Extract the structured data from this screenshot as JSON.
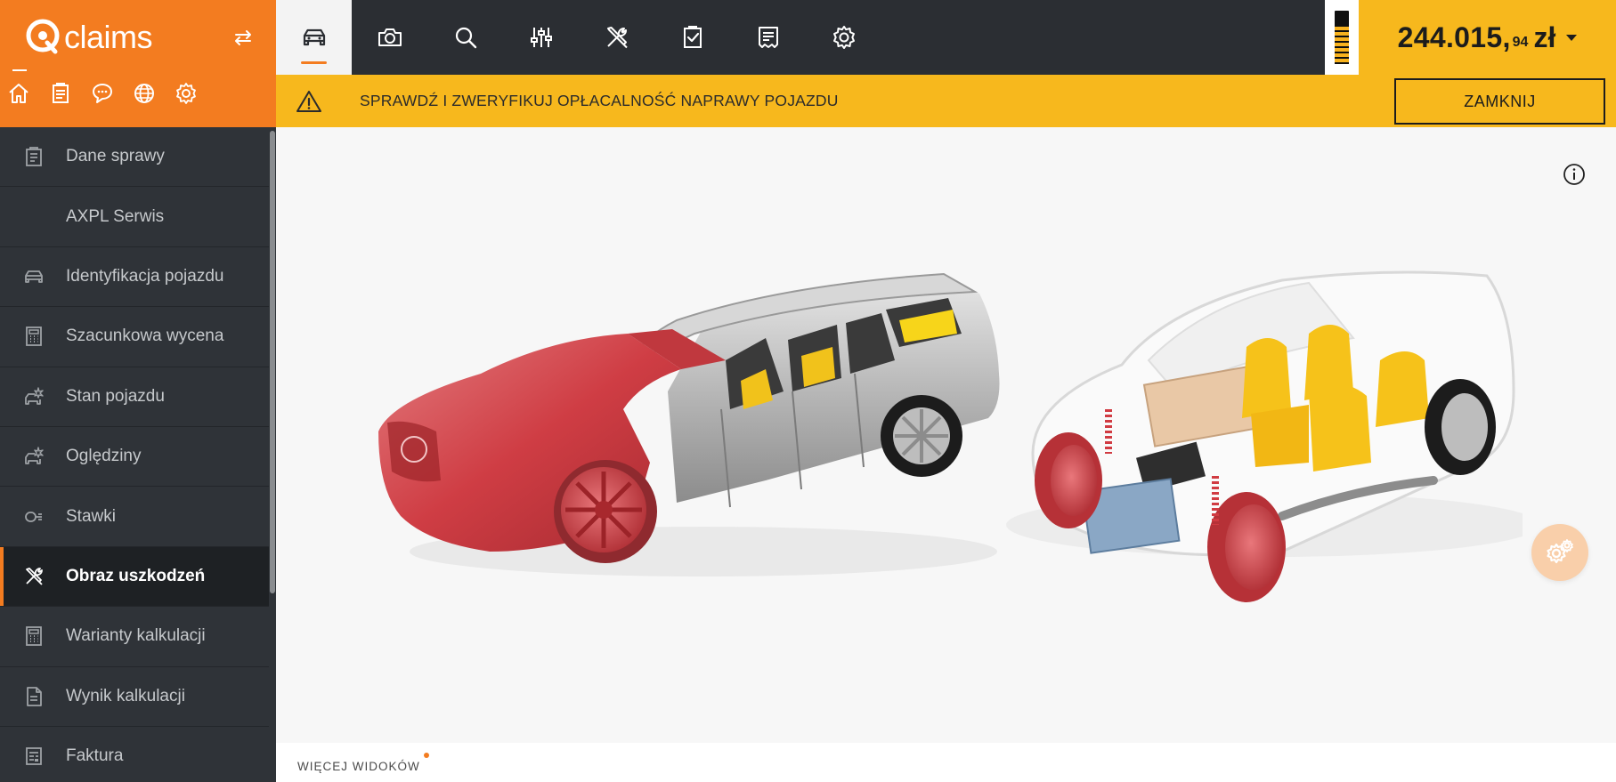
{
  "brand": {
    "logo_text": "claims",
    "accent": "#f37c20"
  },
  "quick_icons": [
    "home-icon",
    "clipboard-icon",
    "chat-icon",
    "globe-icon",
    "gear-icon"
  ],
  "sidebar": {
    "items": [
      {
        "label": "Dane sprawy",
        "icon": "clipboard-icon"
      },
      {
        "label": "AXPL Serwis",
        "icon": ""
      },
      {
        "label": "Identyfikacja pojazdu",
        "icon": "car-icon"
      },
      {
        "label": "Szacunkowa wycena",
        "icon": "calculator-icon"
      },
      {
        "label": "Stan pojazdu",
        "icon": "car-damage-icon"
      },
      {
        "label": "Oględziny",
        "icon": "car-damage-icon"
      },
      {
        "label": "Stawki",
        "icon": "rates-icon"
      },
      {
        "label": "Obraz uszkodzeń",
        "icon": "tools-icon",
        "active": true
      },
      {
        "label": "Warianty kalkulacji",
        "icon": "calculator-icon"
      },
      {
        "label": "Wynik kalkulacji",
        "icon": "document-icon"
      },
      {
        "label": "Faktura",
        "icon": "invoice-icon"
      }
    ]
  },
  "toolbar": {
    "tools": [
      "car-icon",
      "camera-icon",
      "search-icon",
      "sliders-icon",
      "tools-icon",
      "checklist-icon",
      "receipt-icon",
      "gear-icon"
    ],
    "active_index": 0
  },
  "gauge": {
    "level": 0.7
  },
  "amount": {
    "main": "244.015,",
    "cents": "94",
    "currency": "zł"
  },
  "alert": {
    "text": "SPRAWDŹ I ZWERYFIKUJ OPŁACALNOŚĆ NAPRAWY POJAZDU",
    "close_label": "ZAMKNIJ",
    "color": "#f7b81d"
  },
  "footer": {
    "more_views_label": "WIĘCEJ WIDOKÓW"
  }
}
